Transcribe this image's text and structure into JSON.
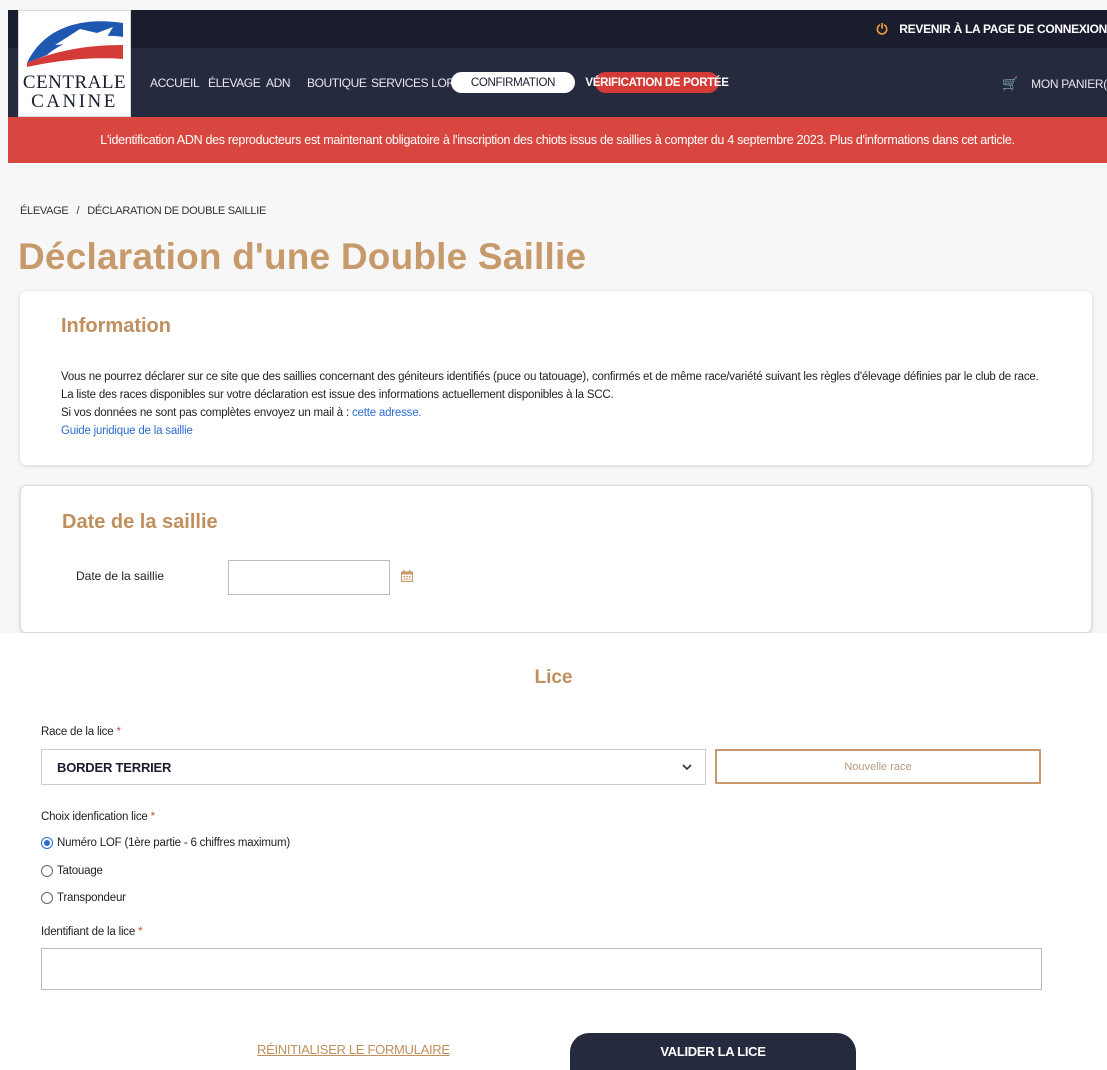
{
  "header": {
    "logo": {
      "line1": "CENTRALE",
      "line2": "CANINE"
    },
    "reconnect_label": "REVENIR À LA PAGE DE CONNEXION",
    "nav": [
      "ACCUEIL",
      "ÉLEVAGE",
      "ADN",
      "BOUTIQUE",
      "SERVICES LOF"
    ],
    "pill_confirmation": "CONFIRMATION",
    "pill_verification": "VÉRIFICATION DE PORTÉE",
    "cart_label": "MON PANIER("
  },
  "alert": "L'identification ADN des reproducteurs est maintenant obligatoire à l'inscription des chiots issus de saillies à compter du 4 septembre 2023. Plus d'informations dans cet article.",
  "breadcrumb": {
    "parent": "ÉLEVAGE",
    "separator": "/",
    "current": "DÉCLARATION DE DOUBLE SAILLIE"
  },
  "page_title": "Déclaration d'une Double Saillie",
  "info": {
    "title": "Information",
    "line1": "Vous ne pourrez déclarer sur ce site que des saillies concernant des géniteurs identifiés (puce ou tatouage), confirmés et de même race/variété suivant les règles d'élevage définies par le club de race.",
    "line2": "La liste des races disponibles sur votre déclaration est issue des informations actuellement disponibles à la SCC.",
    "line3_prefix": "Si vos données ne sont pas complètes envoyez un mail à :",
    "line3_link": "cette adresse.",
    "guide_link": "Guide juridique de la saillie"
  },
  "date_section": {
    "title": "Date de la saillie",
    "label": "Date de la saillie",
    "value": ""
  },
  "lice": {
    "title": "Lice",
    "race_label": "Race de la lice",
    "required_mark": "*",
    "race_value": "BORDER TERRIER",
    "new_race_button": "Nouvelle race",
    "id_choice_label": "Choix idenfication lice",
    "options": [
      {
        "label": "Numéro LOF (1ère partie - 6 chiffres maximum)",
        "selected": true
      },
      {
        "label": "Tatouage",
        "selected": false
      },
      {
        "label": "Transpondeur",
        "selected": false
      }
    ],
    "identifier_label": "Identifiant de la lice",
    "identifier_value": ""
  },
  "actions": {
    "reset": "RÉINITIALISER LE FORMULAIRE",
    "validate": "VALIDER LA LICE"
  },
  "colors": {
    "brand_gold": "#c08f5d",
    "navy": "#262a3e",
    "alert_red": "#d9463f",
    "link_blue": "#2b6cd0"
  }
}
